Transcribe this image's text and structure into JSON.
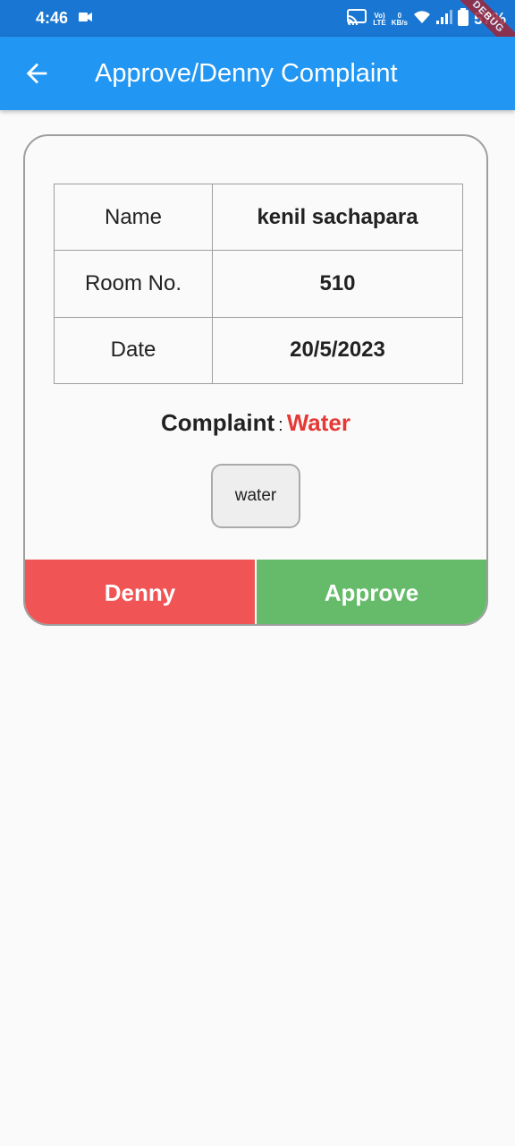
{
  "status_bar": {
    "time": "4:46",
    "network_small": "Vo)\nLTE",
    "speed_value": "0",
    "speed_unit": "KB/s",
    "battery": "57%"
  },
  "debug_banner": "DEBUG",
  "app_bar": {
    "title": "Approve/Denny Complaint",
    "back_icon": "arrow-back-icon"
  },
  "details": {
    "rows": [
      {
        "label": "Name",
        "value": "kenil sachapara"
      },
      {
        "label": "Room No.",
        "value": "510"
      },
      {
        "label": "Date",
        "value": "20/5/2023"
      }
    ]
  },
  "complaint": {
    "label": "Complaint",
    "separator": ":",
    "type": "Water",
    "description": "water"
  },
  "actions": {
    "deny_label": "Denny",
    "approve_label": "Approve"
  },
  "colors": {
    "status_bar": "#1976d2",
    "app_bar": "#2196f3",
    "deny": "#f05454",
    "approve": "#66bb6a",
    "complaint_type": "#e53935"
  }
}
